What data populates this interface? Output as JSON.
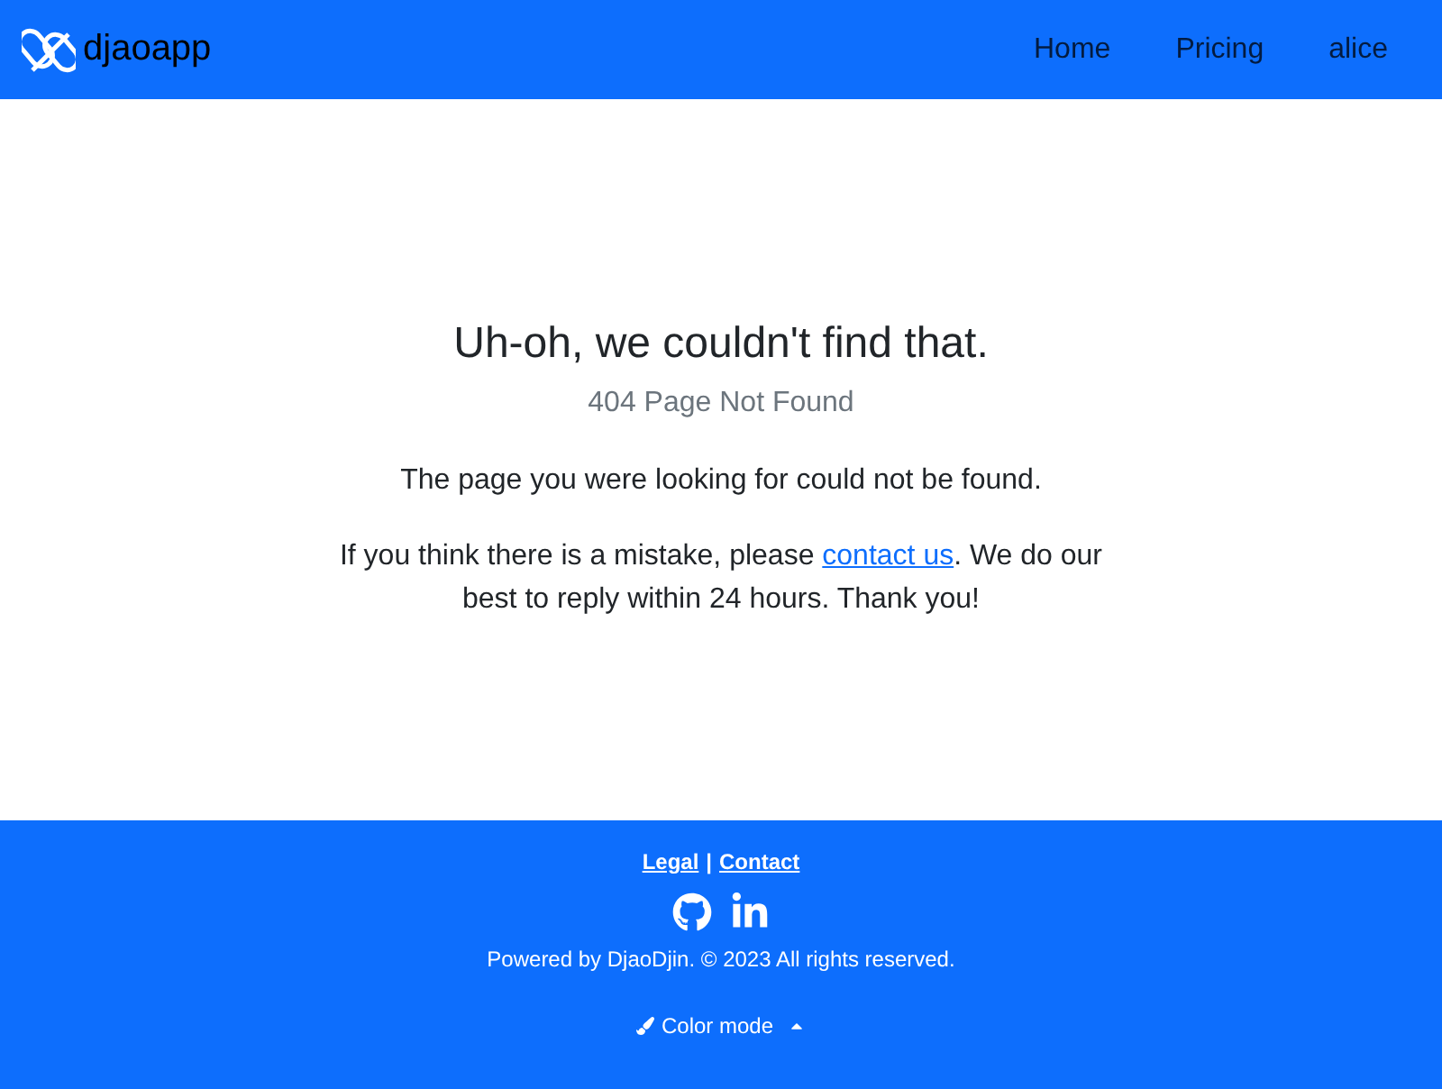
{
  "navbar": {
    "brand": "djaoapp",
    "links": [
      {
        "label": "Home"
      },
      {
        "label": "Pricing"
      },
      {
        "label": "alice"
      }
    ]
  },
  "error": {
    "title": "Uh-oh, we couldn't find that.",
    "subtitle": "404 Page Not Found",
    "message": "The page you were looking for could not be found.",
    "help": {
      "before": "If you think there is a mistake, please ",
      "link": "contact us",
      "after": ". We do our best to reply within 24 hours. Thank you!"
    }
  },
  "footer": {
    "links": [
      {
        "label": "Legal"
      },
      {
        "label": "Contact"
      }
    ],
    "separator": "|",
    "powered": "Powered by DjaoDjin. © 2023 All rights reserved.",
    "color_mode": "Color mode"
  }
}
